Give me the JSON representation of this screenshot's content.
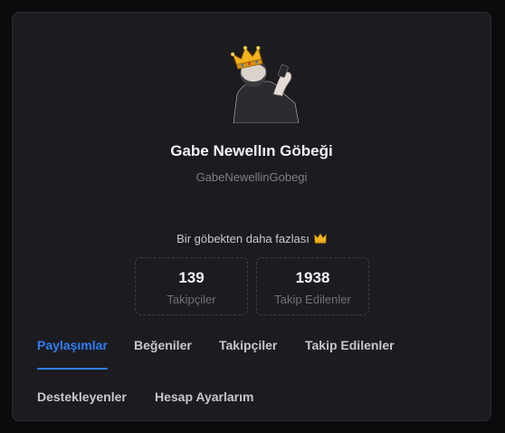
{
  "profile": {
    "display_name": "Gabe Newellın Göbeği",
    "username": "GabeNewellinGobegi",
    "bio": "Bir göbekten daha fazlası",
    "bio_emoji": "crown-icon"
  },
  "stats": [
    {
      "value": "139",
      "label": "Takipçiler"
    },
    {
      "value": "1938",
      "label": "Takip Edilenler"
    }
  ],
  "tabs": [
    {
      "label": "Paylaşımlar",
      "active": true
    },
    {
      "label": "Beğeniler",
      "active": false
    },
    {
      "label": "Takipçiler",
      "active": false
    },
    {
      "label": "Takip Edilenler",
      "active": false
    },
    {
      "label": "Destekleyenler",
      "active": false
    },
    {
      "label": "Hesap Ayarlarım",
      "active": false
    }
  ],
  "colors": {
    "background": "#0b0b0d",
    "card": "#1c1c20",
    "accent": "#2f7df6"
  }
}
